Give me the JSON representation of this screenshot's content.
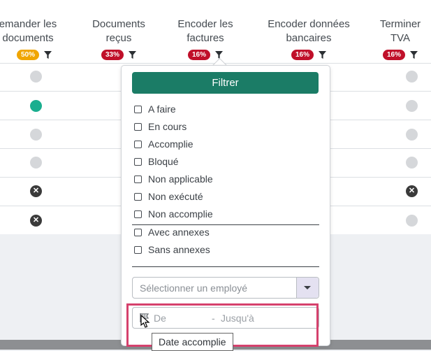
{
  "columns": [
    {
      "title1": "emander les",
      "title2": "documents",
      "badge": "50%",
      "badge_color": "#f0a500"
    },
    {
      "title1": "Documents",
      "title2": "reçus",
      "badge": "33%",
      "badge_color": "#c0102a"
    },
    {
      "title1": "Encoder les",
      "title2": "factures",
      "badge": "16%",
      "badge_color": "#c0102a"
    },
    {
      "title1": "Encoder données",
      "title2": "bancaires",
      "badge": "16%",
      "badge_color": "#c0102a"
    },
    {
      "title1": "Terminer",
      "title2": "TVA",
      "badge": "16%",
      "badge_color": "#c0102a"
    }
  ],
  "filter_popup": {
    "filter_button": "Filtrer",
    "status_options": [
      "A faire",
      "En cours",
      "Accomplie",
      "Bloqué",
      "Non applicable",
      "Non exécuté",
      "Non accomplie"
    ],
    "annex_options": [
      "Avec annexes",
      "Sans annexes"
    ],
    "employee_placeholder": "Sélectionner un employé",
    "date_from": "De",
    "date_separator": "-",
    "date_to": "Jusqu'à"
  },
  "tooltip": "Date accomplie",
  "icons": {
    "filter": "funnel-icon",
    "dropdown": "caret-down-icon",
    "date": "flag-icon",
    "status_cancel": "x-circle-icon"
  },
  "colors": {
    "primary": "#1b7c66",
    "highlight": "#d5416d",
    "status_done": "#1aae8f"
  }
}
